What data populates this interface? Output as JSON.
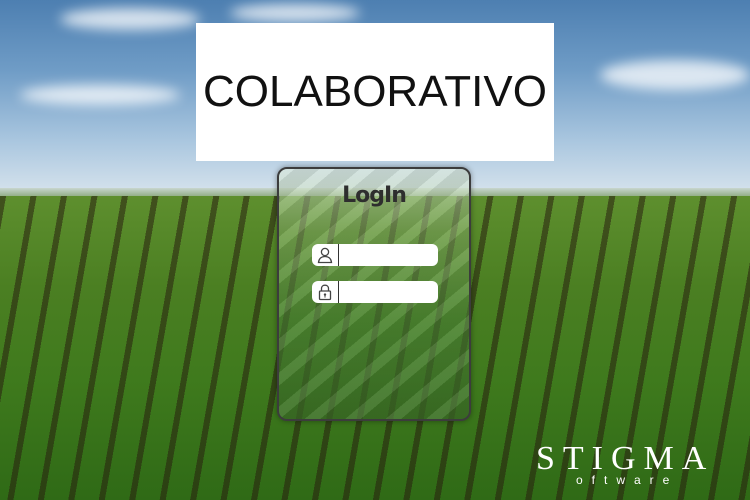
{
  "header": {
    "title": "COLABORATIVO"
  },
  "login": {
    "title": "LogIn",
    "username": {
      "icon": "user-icon",
      "value": "",
      "placeholder": ""
    },
    "password": {
      "icon": "lock-icon",
      "value": "",
      "placeholder": ""
    }
  },
  "brand": {
    "name": "STIGMA",
    "sub": "oftware"
  }
}
